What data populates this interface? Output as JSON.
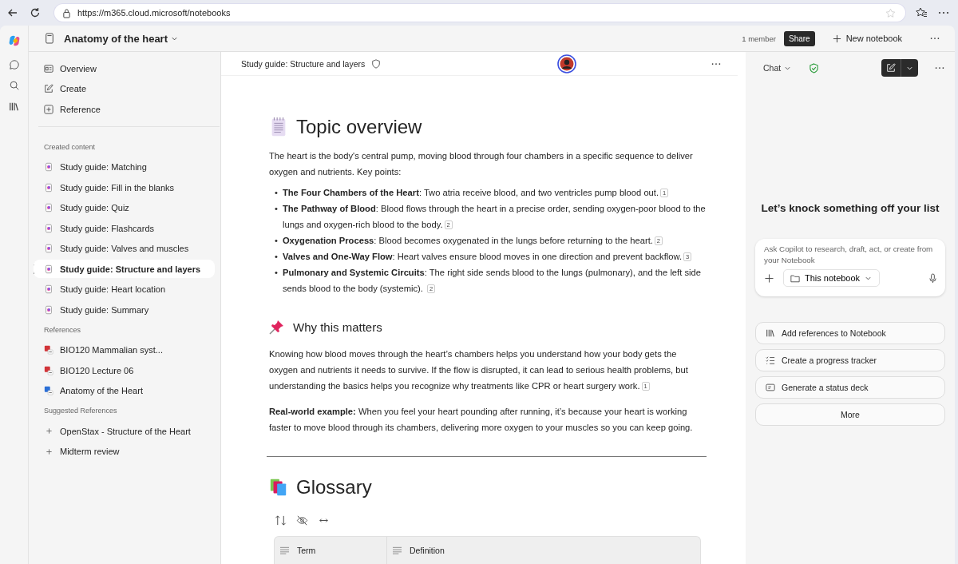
{
  "browser": {
    "url": "https://m365.cloud.microsoft/notebooks"
  },
  "header": {
    "title": "Anatomy of the heart",
    "members": "1 member",
    "share": "Share",
    "new_notebook": "New notebook"
  },
  "sidebar": {
    "nav": [
      {
        "label": "Overview",
        "kind": "overview"
      },
      {
        "label": "Create",
        "kind": "create"
      },
      {
        "label": "Reference",
        "kind": "reference"
      }
    ],
    "created_heading": "Created content",
    "created": [
      {
        "label": "Study guide: Matching",
        "selected": false
      },
      {
        "label": "Study guide: Fill in the blanks",
        "selected": false
      },
      {
        "label": "Study guide: Quiz",
        "selected": false
      },
      {
        "label": "Study guide: Flashcards",
        "selected": false
      },
      {
        "label": "Study guide: Valves and muscles",
        "selected": false
      },
      {
        "label": "Study guide: Structure and layers",
        "selected": true
      },
      {
        "label": "Study guide: Heart location",
        "selected": false
      },
      {
        "label": "Study guide: Summary",
        "selected": false
      }
    ],
    "references_heading": "References",
    "references": [
      {
        "label": "BIO120 Mammalian syst...",
        "color": "#d13438"
      },
      {
        "label": "BIO120 Lecture 06",
        "color": "#d13438"
      },
      {
        "label": "Anatomy of the Heart",
        "color": "#2b6fd6"
      }
    ],
    "suggested_heading": "Suggested References",
    "suggested": [
      {
        "label": "OpenStax - Structure of the Heart"
      },
      {
        "label": "Midterm review"
      }
    ]
  },
  "document": {
    "tab_title": "Study guide: Structure and layers",
    "title": "Topic overview",
    "intro": "The heart is the body's central pump, moving blood through four chambers in a specific sequence to deliver oxygen and nutrients. Key points:",
    "points": [
      {
        "marker": "•",
        "term": "The Four Chambers of the Heart",
        "text": ": Two atria receive blood, and two ventricles pump blood out.",
        "cite": "1"
      },
      {
        "marker": "•",
        "term": "The Pathway of Blood",
        "text": ": Blood flows through the heart in a precise order, sending oxygen-poor blood to the lungs and oxygen-rich blood to the body.",
        "cite": "2"
      },
      {
        "marker": "•",
        "term": "Oxygenation Process",
        "text": ": Blood becomes oxygenated in the lungs before returning to the heart.",
        "cite": "2"
      },
      {
        "marker": "•",
        "term": "Valves and One-Way Flow",
        "text": ": Heart valves ensure blood moves in one direction and prevent backflow.",
        "cite": "3"
      },
      {
        "marker": "•",
        "term": "Pulmonary and Systemic Circuits",
        "text": ": The right side sends blood to the lungs (pulmonary), and the left side sends blood to the body (systemic). ",
        "cite": "2"
      }
    ],
    "why_heading": "Why this matters",
    "why_text": "Knowing how blood moves through the heart’s chambers helps you understand how your body gets the oxygen and nutrients it needs to survive. If the flow is disrupted, it can lead to serious health problems, but understanding the basics helps you recognize why treatments like CPR or heart surgery work.",
    "why_cite": "1",
    "example": "**Real-world example:** When you feel your heart pounding after running, it’s because your heart is working faster to move blood through its chambers, delivering more oxygen to your muscles so you can keep going.",
    "glossary_heading": "Glossary",
    "table_columns": [
      "Term",
      "Definition"
    ]
  },
  "chat": {
    "title": "Chat",
    "heading": "Let’s knock something off your list",
    "placeholder": "Ask Copilot to research, draft, act, or create from your Notebook",
    "scope": "This notebook",
    "actions": [
      {
        "label": "Add references to Notebook",
        "kind": "books"
      },
      {
        "label": "Create a progress tracker",
        "kind": "checklist"
      },
      {
        "label": "Generate a status deck",
        "kind": "deck"
      }
    ],
    "more": "More"
  }
}
